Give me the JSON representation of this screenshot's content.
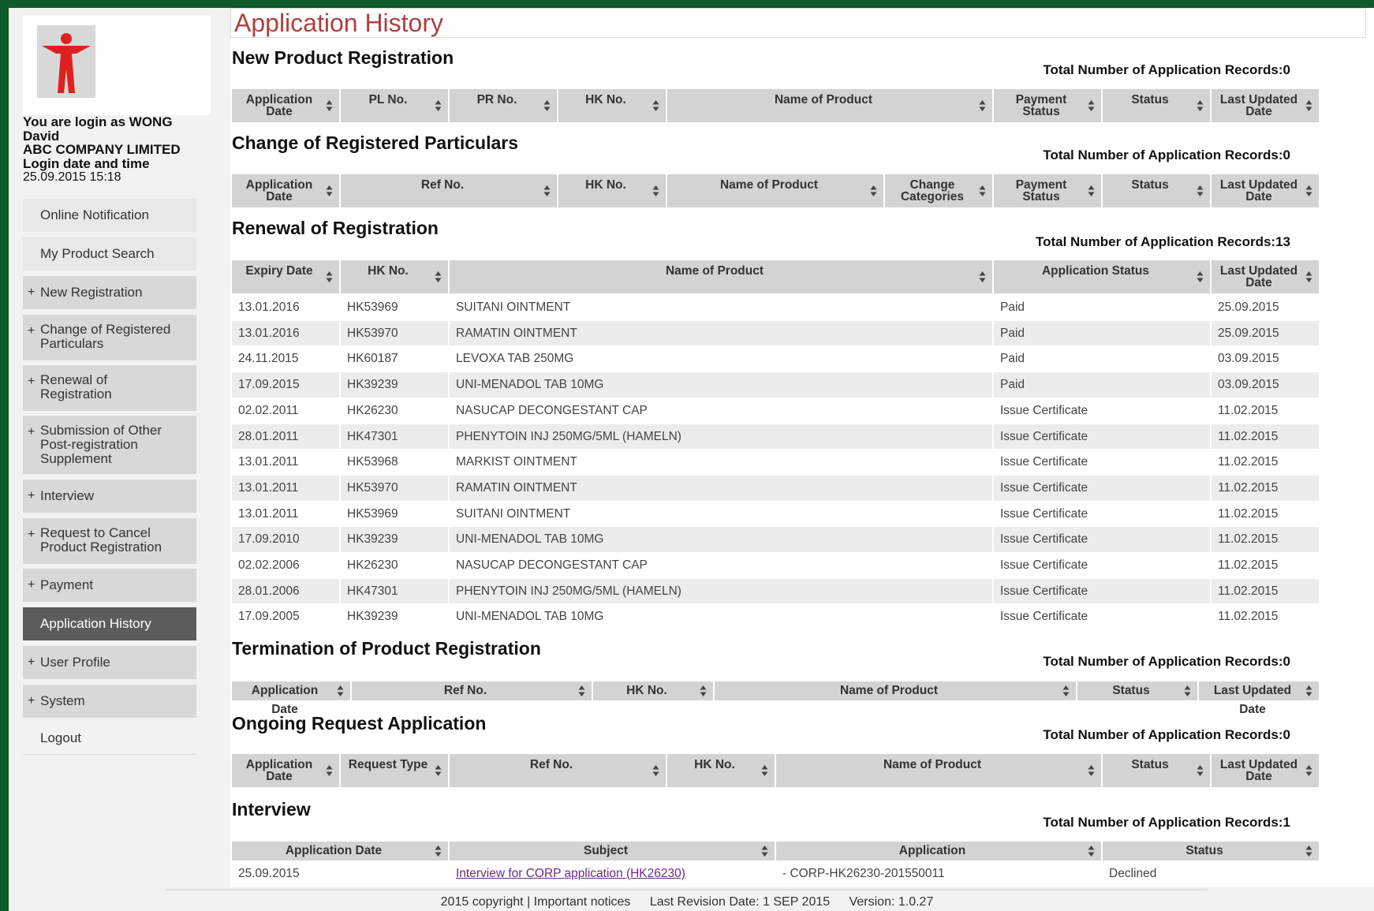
{
  "page": {
    "title": "Application History"
  },
  "user": {
    "login_line1": "You are login as WONG",
    "login_line2": "David",
    "company": "ABC COMPANY LIMITED",
    "login_label": "Login date and time",
    "login_time": "25.09.2015 15:18"
  },
  "nav": {
    "items": [
      {
        "label": "Online Notification",
        "expandable": false
      },
      {
        "label": "My Product Search",
        "expandable": false
      },
      {
        "label": "New Registration",
        "expandable": true
      },
      {
        "label": "Change of Registered Particulars",
        "expandable": true
      },
      {
        "label": "Renewal of Registration",
        "expandable": true
      },
      {
        "label": "Submission of Other Post-registration Supplement",
        "expandable": true
      },
      {
        "label": "Interview",
        "expandable": true
      },
      {
        "label": "Request to Cancel Product Registration",
        "expandable": true
      },
      {
        "label": "Payment",
        "expandable": true
      },
      {
        "label": "Application History",
        "expandable": false,
        "active": true
      },
      {
        "label": "User Profile",
        "expandable": true
      },
      {
        "label": "System",
        "expandable": true
      },
      {
        "label": "Logout",
        "expandable": false
      }
    ],
    "plus_symbol": "+"
  },
  "sections": {
    "new_product": {
      "title": "New Product Registration",
      "total": "Total Number of Application Records:0",
      "headers": [
        "Application Date",
        "PL No.",
        "PR No.",
        "HK No.",
        "Name of Product",
        "Payment Status",
        "Status",
        "Last Updated Date"
      ]
    },
    "change": {
      "title": "Change of Registered Particulars",
      "total": "Total Number of Application Records:0",
      "headers": [
        "Application Date",
        "Ref No.",
        "HK No.",
        "Name of Product",
        "Change Categories",
        "Payment Status",
        "Status",
        "Last Updated Date"
      ]
    },
    "renewal": {
      "title": "Renewal of Registration",
      "total": "Total Number of Application Records:13",
      "headers": [
        "Expiry Date",
        "HK No.",
        "Name of Product",
        "Application Status",
        "Last Updated Date"
      ],
      "rows": [
        [
          "13.01.2016",
          "HK53969",
          "SUITANI OINTMENT",
          "Paid",
          "25.09.2015"
        ],
        [
          "13.01.2016",
          "HK53970",
          "RAMATIN OINTMENT",
          "Paid",
          "25.09.2015"
        ],
        [
          "24.11.2015",
          "HK60187",
          "LEVOXA TAB 250MG",
          "Paid",
          "03.09.2015"
        ],
        [
          "17.09.2015",
          "HK39239",
          "UNI-MENADOL TAB 10MG",
          "Paid",
          "03.09.2015"
        ],
        [
          "02.02.2011",
          "HK26230",
          "NASUCAP DECONGESTANT CAP",
          "Issue Certificate",
          "11.02.2015"
        ],
        [
          "28.01.2011",
          "HK47301",
          "PHENYTOIN INJ 250MG/5ML (HAMELN)",
          "Issue Certificate",
          "11.02.2015"
        ],
        [
          "13.01.2011",
          "HK53968",
          "MARKIST OINTMENT",
          "Issue Certificate",
          "11.02.2015"
        ],
        [
          "13.01.2011",
          "HK53970",
          "RAMATIN OINTMENT",
          "Issue Certificate",
          "11.02.2015"
        ],
        [
          "13.01.2011",
          "HK53969",
          "SUITANI OINTMENT",
          "Issue Certificate",
          "11.02.2015"
        ],
        [
          "17.09.2010",
          "HK39239",
          "UNI-MENADOL TAB 10MG",
          "Issue Certificate",
          "11.02.2015"
        ],
        [
          "02.02.2006",
          "HK26230",
          "NASUCAP DECONGESTANT CAP",
          "Issue Certificate",
          "11.02.2015"
        ],
        [
          "28.01.2006",
          "HK47301",
          "PHENYTOIN INJ 250MG/5ML (HAMELN)",
          "Issue Certificate",
          "11.02.2015"
        ],
        [
          "17.09.2005",
          "HK39239",
          "UNI-MENADOL TAB 10MG",
          "Issue Certificate",
          "11.02.2015"
        ]
      ]
    },
    "termination": {
      "title": "Termination of Product Registration",
      "total": "Total Number of Application Records:0",
      "headers": [
        "Application Date",
        "Ref No.",
        "HK No.",
        "Name of Product",
        "Status",
        "Last Updated Date"
      ]
    },
    "ongoing": {
      "title": "Ongoing Request Application",
      "total": "Total Number of Application Records:0",
      "headers": [
        "Application Date",
        "Request Type",
        "Ref No.",
        "HK No.",
        "Name of Product",
        "Status",
        "Last Updated Date"
      ]
    },
    "interview": {
      "title": "Interview",
      "total": "Total Number of Application Records:1",
      "headers": [
        "Application Date",
        "Subject",
        "Application",
        "Status"
      ],
      "rows": [
        [
          "25.09.2015",
          "Interview for CORP application (HK26230)",
          "- CORP-HK26230-201550011",
          "Declined"
        ]
      ]
    }
  },
  "footer": {
    "copyright": "2015 copyright | Important notices",
    "revision": "Last Revision Date: 1 SEP 2015",
    "version": "Version: 1.0.27"
  },
  "colors": {
    "border_green": "#0e5a2a",
    "title_red": "#b04040",
    "logo_red": "#e02020",
    "active_nav": "#5c5c5c",
    "header_gray": "#d3d3d3",
    "link_purple": "#6a2a8a"
  },
  "icons": {
    "sort": "sort-icon",
    "logo": "logo-icon"
  }
}
